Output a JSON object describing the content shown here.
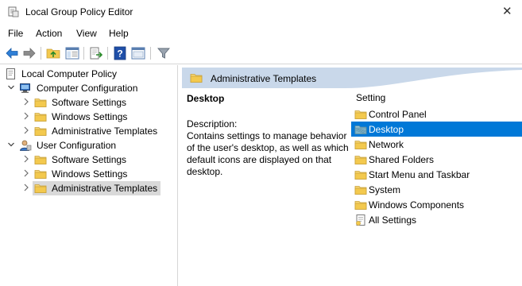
{
  "window": {
    "title": "Local Group Policy Editor",
    "close_glyph": "✕"
  },
  "menu": [
    "File",
    "Action",
    "View",
    "Help"
  ],
  "toolbar": {
    "buttons": [
      "back-arrow-icon",
      "forward-arrow-icon",
      "up-folder-icon",
      "show-hide-tree-icon",
      "export-list-icon",
      "help-icon",
      "properties-icon",
      "filter-icon"
    ]
  },
  "tree": {
    "root": "Local Computer Policy",
    "computer_config": "Computer Configuration",
    "user_config": "User Configuration",
    "software_settings": "Software Settings",
    "windows_settings": "Windows Settings",
    "admin_templates": "Administrative Templates"
  },
  "details": {
    "header": "Administrative Templates",
    "section_title": "Desktop",
    "description_label": "Description:",
    "description_text": "Contains settings to manage behavior of the user's desktop, as well as which default icons are displayed on that desktop.",
    "column_header": "Setting",
    "items": [
      {
        "label": "Control Panel",
        "icon": "folder"
      },
      {
        "label": "Desktop",
        "icon": "folder-selected"
      },
      {
        "label": "Network",
        "icon": "folder"
      },
      {
        "label": "Shared Folders",
        "icon": "folder"
      },
      {
        "label": "Start Menu and Taskbar",
        "icon": "folder"
      },
      {
        "label": "System",
        "icon": "folder"
      },
      {
        "label": "Windows Components",
        "icon": "folder"
      },
      {
        "label": "All Settings",
        "icon": "settings-page"
      }
    ],
    "selected_index": 1
  },
  "colors": {
    "selection_blue": "#0078d7",
    "header_band": "#c9d8ea",
    "tree_selection": "#d9d9d9",
    "folder_yellow": "#f3c94e"
  }
}
